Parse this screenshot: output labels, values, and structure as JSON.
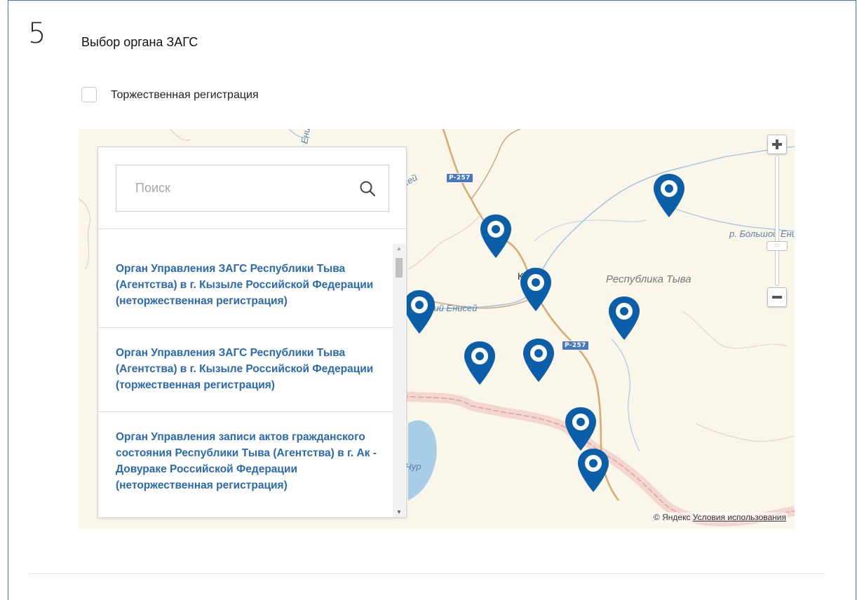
{
  "step": {
    "number": "5",
    "title": "Выбор органа ЗАГС"
  },
  "options": {
    "ceremonial_label": "Торжественная регистрация",
    "ceremonial_checked": false
  },
  "search": {
    "placeholder": "Поиск",
    "value": ""
  },
  "offices": [
    {
      "label": "Орган Управления ЗАГС Республики Тыва (Агентства) в г. Кызыле Российской Федерации (неторжественная регистрация)"
    },
    {
      "label": "Орган Управления ЗАГС Республики Тыва (Агентства) в г. Кызыле Российской Федерации (торжественная регистрация)"
    },
    {
      "label": "Орган Управления записи актов гражданского состояния Республики Тыва (Агентства) в г. Ак - Довураке Российской Федерации (неторжественная регистрация)"
    }
  ],
  "map": {
    "labels": {
      "river_bolshoy_1": "р. Большой Енисей",
      "river_bolshoy_2": "р. Большой Ени",
      "river_verkhniy": "Верхний Енисей",
      "river_top": "Ени",
      "region": "Республика Тыва",
      "city": "Кызыл",
      "lake": "Чур"
    },
    "road_badges": [
      "Р-257",
      "Р-257"
    ],
    "pin_color": "#0a5fa8",
    "copyright": "© Яндекс",
    "terms_link": "Условия использования",
    "zoom_in_icon": "plus-icon",
    "zoom_out_icon": "minus-icon"
  },
  "colors": {
    "accent": "#2a69b3",
    "frame_border": "#3b7bbf"
  }
}
